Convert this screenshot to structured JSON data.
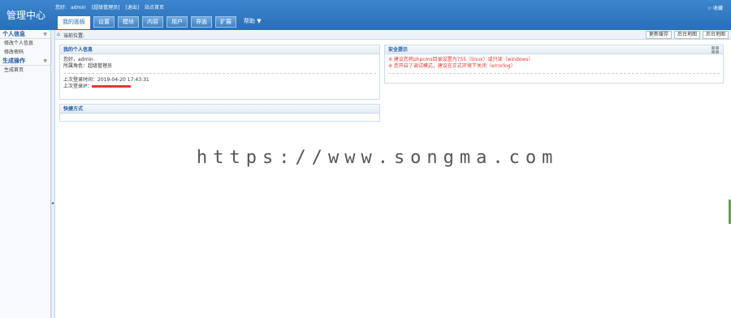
{
  "header": {
    "title": "管理中心",
    "user_prefix": "您好:",
    "username": "admin",
    "role_link": "[超级管理员]",
    "logout": "[退出]",
    "site_home": "站点首页",
    "top_right": "收藏"
  },
  "nav": {
    "tabs": [
      {
        "label": "我的面板",
        "active": true
      },
      {
        "label": "设置"
      },
      {
        "label": "模块"
      },
      {
        "label": "内容"
      },
      {
        "label": "用户"
      },
      {
        "label": "界面"
      },
      {
        "label": "扩展"
      },
      {
        "label": "帮助"
      }
    ],
    "more_arrow": "▼"
  },
  "sidebar": {
    "sections": [
      {
        "title": "个人信息",
        "items": [
          "修改个人信息",
          "修改密码"
        ]
      },
      {
        "title": "生成操作",
        "items": [
          "生成首页"
        ]
      }
    ]
  },
  "breadcrumb": {
    "label": "当前位置:",
    "buttons": [
      "更新缓存",
      "后台地图",
      "后台地图"
    ]
  },
  "panels": {
    "personal": {
      "title": "我的个人信息",
      "greeting": "您好，admin",
      "role": "所属角色：超级管理员",
      "last_login_time": "上次登录时间：2019-04-20 17:43:31",
      "last_login_ip_label": "上次登录IP："
    },
    "shortcut": {
      "title": "快捷方式"
    },
    "security": {
      "title": "安全提示",
      "items": [
        "※ 建议您将phpcms目录设置为755（linux）或只读（windows）",
        "※ 您开启了调试模式，建议在正式环境下关闭（errorlog）"
      ]
    }
  },
  "watermark": "https://www.songma.com",
  "colors": {
    "header": "#2f77c0",
    "accent": "#1d5aa0",
    "warning": "#e33333"
  }
}
